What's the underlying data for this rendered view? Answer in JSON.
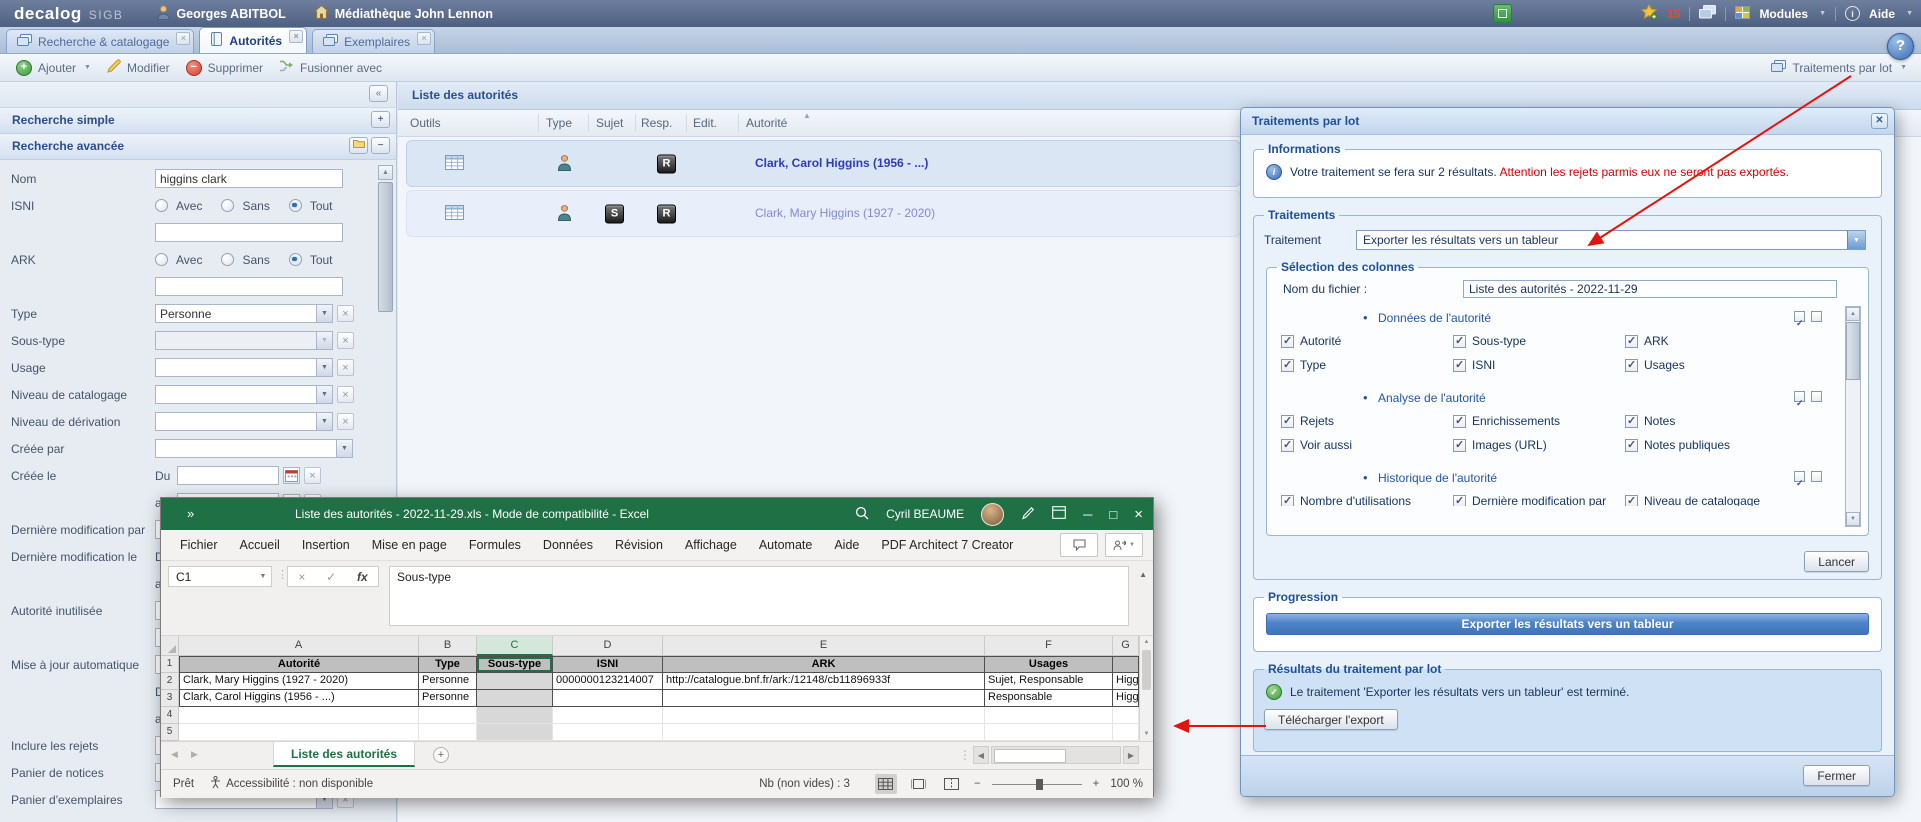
{
  "topbar": {
    "logo": "decalog",
    "logo_suffix": "SIGB",
    "user": "Georges ABITBOL",
    "library": "Médiathèque John Lennon",
    "favorites_count": "15",
    "modules": "Modules",
    "aide": "Aide"
  },
  "tabs": [
    {
      "label": "Recherche & catalogage",
      "icon": "pages-icon",
      "active": false
    },
    {
      "label": "Autorités",
      "icon": "book-icon",
      "active": true
    },
    {
      "label": "Exemplaires",
      "icon": "pages-icon",
      "active": false
    }
  ],
  "toolbar": {
    "ajouter": "Ajouter",
    "modifier": "Modifier",
    "supprimer": "Supprimer",
    "fusionner": "Fusionner avec",
    "traitements_par_lot": "Traitements par lot"
  },
  "search_panel": {
    "simple_header": "Recherche simple",
    "advanced_header": "Recherche avancée",
    "rows": [
      {
        "label": "Nom",
        "control": "text",
        "value": "higgins clark"
      },
      {
        "label": "ISNI",
        "control": "radios",
        "options": [
          "Avec",
          "Sans",
          "Tout"
        ],
        "selected": 2
      },
      {
        "label": "",
        "control": "text",
        "value": ""
      },
      {
        "label": "ARK",
        "control": "radios",
        "options": [
          "Avec",
          "Sans",
          "Tout"
        ],
        "selected": 2
      },
      {
        "label": "",
        "control": "text",
        "value": ""
      },
      {
        "label": "Type",
        "control": "select",
        "value": "Personne",
        "clearable": true
      },
      {
        "label": "Sous-type",
        "control": "select",
        "value": "",
        "disabled": true,
        "clearable": true
      },
      {
        "label": "Usage",
        "control": "select",
        "value": "",
        "clearable": true
      },
      {
        "label": "Niveau de catalogage",
        "control": "select",
        "value": "",
        "clearable": true
      },
      {
        "label": "Niveau de dérivation",
        "control": "select",
        "value": "",
        "clearable": true
      },
      {
        "label": "Créée par",
        "control": "select",
        "value": "",
        "wide": true
      },
      {
        "label": "Créée le",
        "control": "date",
        "prefix": "Du"
      },
      {
        "label": "",
        "control": "date",
        "prefix": "au"
      },
      {
        "label": "Dernière modification par",
        "control": "text",
        "value": ""
      },
      {
        "label": "Dernière modification le",
        "control": "date",
        "prefix": "Du"
      },
      {
        "label": "",
        "control": "date",
        "prefix": "au"
      },
      {
        "label": "Autorité inutilisée",
        "control": "text",
        "value": ""
      },
      {
        "label": "",
        "control": "text",
        "value": ""
      },
      {
        "label": "Mise à jour automatique",
        "control": "select",
        "value": "",
        "clearable": true
      },
      {
        "label": "",
        "control": "date",
        "prefix": "Du"
      },
      {
        "label": "",
        "control": "date",
        "prefix": "au"
      },
      {
        "label": "Inclure les rejets",
        "control": "text",
        "value": ""
      },
      {
        "label": "Panier de notices",
        "control": "select",
        "value": ""
      },
      {
        "label": "Panier d'exemplaires",
        "control": "select",
        "value": "",
        "clearable": true
      }
    ]
  },
  "list": {
    "title": "Liste des autorités",
    "columns": [
      "Outils",
      "Type",
      "Sujet",
      "Resp.",
      "Edit.",
      "Autorité"
    ],
    "sort_column": "Autorité",
    "rows": [
      {
        "name": "Clark, Carol Higgins (1956 - ...)",
        "sujet": "",
        "resp": "R",
        "selected": true
      },
      {
        "name": "Clark, Mary Higgins (1927 - 2020)",
        "sujet": "S",
        "resp": "R",
        "selected": false
      }
    ]
  },
  "dialog": {
    "title": "Traitements par lot",
    "informations": {
      "legend": "Informations",
      "text": "Votre traitement se fera sur 2 résultats.",
      "warning": "Attention les rejets parmis eux ne seront pas exportés."
    },
    "traitements": {
      "legend": "Traitements",
      "field_label": "Traitement",
      "value": "Exporter les résultats vers un tableur"
    },
    "selection": {
      "legend": "Sélection des colonnes",
      "filename_label": "Nom du fichier :",
      "filename": "Liste des autorités - 2022-11-29",
      "sections": [
        {
          "title": "Données de l'autorité",
          "items": [
            "Autorité",
            "Sous-type",
            "ARK",
            "Type",
            "ISNI",
            "Usages"
          ]
        },
        {
          "title": "Analyse de l'autorité",
          "items": [
            "Rejets",
            "Enrichissements",
            "Notes",
            "Voir aussi",
            "Images (URL)",
            "Notes publiques"
          ]
        },
        {
          "title": "Historique de l'autorité",
          "items": [
            "Nombre d'utilisations",
            "Dernière modification par",
            "Niveau de catalogage"
          ]
        }
      ]
    },
    "lancer": "Lancer",
    "progression": {
      "legend": "Progression",
      "bar_label": "Exporter les résultats vers un tableur"
    },
    "resultats": {
      "legend": "Résultats du traitement par lot",
      "message": "Le traitement 'Exporter les résultats vers un tableur' est terminé.",
      "download": "Télécharger l'export"
    },
    "fermer": "Fermer"
  },
  "excel": {
    "title": "Liste des autorités - 2022-11-29.xls  -  Mode de compatibilité  -  Excel",
    "account": "Cyril BEAUME",
    "ribbon_tabs": [
      "Fichier",
      "Accueil",
      "Insertion",
      "Mise en page",
      "Formules",
      "Données",
      "Révision",
      "Affichage",
      "Automate",
      "Aide",
      "PDF Architect 7 Creator"
    ],
    "name_box": "C1",
    "formula": "Sous-type",
    "column_letters": [
      "A",
      "B",
      "C",
      "D",
      "E",
      "F",
      "G"
    ],
    "row_numbers": [
      "1",
      "2",
      "3",
      "4",
      "5"
    ],
    "selected_column": "C",
    "grid": [
      [
        "Autorité",
        "Type",
        "Sous-type",
        "ISNI",
        "ARK",
        "Usages",
        ""
      ],
      [
        "Clark, Mary Higgins (1927 - 2020)",
        "Personne",
        "",
        "0000000123214007",
        "http://catalogue.bnf.fr/ark:/12148/cb11896933f",
        "Sujet, Responsable",
        "Higg"
      ],
      [
        "Clark, Carol Higgins (1956 - ...)",
        "Personne",
        "",
        "",
        "",
        "Responsable",
        "Higg"
      ],
      [
        "",
        "",
        "",
        "",
        "",
        "",
        ""
      ],
      [
        "",
        "",
        "",
        "",
        "",
        "",
        ""
      ]
    ],
    "sheet_tab": "Liste des autorités",
    "status": {
      "ready": "Prêt",
      "accessibility": "Accessibilité : non disponible",
      "count": "Nb (non vides) : 3",
      "zoom": "100 %"
    }
  },
  "annotations": {
    "arrow_color": "#e3140f",
    "arrows": [
      {
        "name": "traitements-to-select-arrow"
      },
      {
        "name": "download-to-excel-arrow"
      }
    ]
  }
}
